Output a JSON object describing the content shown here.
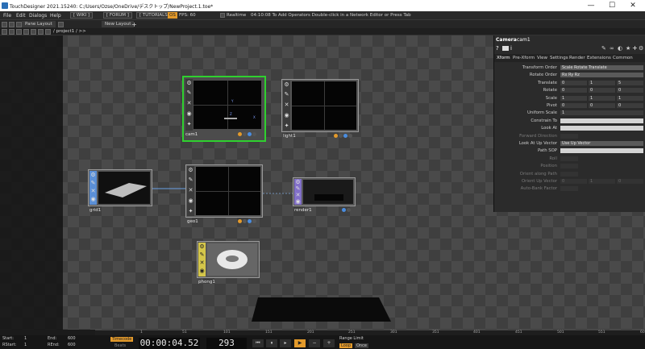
{
  "window": {
    "title": "TouchDesigner 2021.15240: C:/Users/Ozse/OneDrive/デスクトップ/NewProject.1.toe*",
    "minimize": "—",
    "maximize": "☐",
    "close": "✕"
  },
  "menu": {
    "items": [
      "File",
      "Edit",
      "Dialogs",
      "Help"
    ],
    "wiki": "[ WIKI ]",
    "forum": "[ FORUM ]",
    "tutorials": "[ TUTORIALS ]",
    "os_tag": "OS",
    "fps": "FPS:  60",
    "realtime": "Realtime",
    "status": "04:10:08 To Add Operators Double-click in a Network Editor or Press Tab"
  },
  "panebar": {
    "pane_layout": "Pane Layout",
    "new_layout": "New Layout",
    "add": "+"
  },
  "pathbar": {
    "path": "/  project1  /  >>"
  },
  "nodes": {
    "cam1": {
      "label": "cam1",
      "axis_y": "Y",
      "axis_x": "X",
      "axis_z": "Z"
    },
    "light1": {
      "label": "light1"
    },
    "grid1": {
      "label": "grid1"
    },
    "geo1": {
      "label": "geo1"
    },
    "render1": {
      "label": "render1"
    },
    "phong1": {
      "label": "phong1"
    }
  },
  "params": {
    "type": "Camera",
    "name": "cam1",
    "tabs": [
      "Xform",
      "Pre-Xform",
      "View",
      "Settings",
      "Render",
      "Extensions",
      "Common"
    ],
    "rows": [
      {
        "label": "Transform Order",
        "kind": "menu",
        "value": "Scale Rotate Translate"
      },
      {
        "label": "Rotate Order",
        "kind": "menu",
        "value": "Rx Ry Rz"
      },
      {
        "label": "Translate",
        "kind": "xyz",
        "values": [
          "0",
          "1",
          "5"
        ]
      },
      {
        "label": "Rotate",
        "kind": "xyz",
        "values": [
          "0",
          "0",
          "0"
        ]
      },
      {
        "label": "Scale",
        "kind": "xyz",
        "values": [
          "1",
          "1",
          "1"
        ]
      },
      {
        "label": "Pivot",
        "kind": "xyz",
        "values": [
          "0",
          "0",
          "0"
        ]
      },
      {
        "label": "Uniform Scale",
        "kind": "num",
        "value": "1"
      },
      {
        "label": "Constrain To",
        "kind": "field",
        "value": ""
      },
      {
        "label": "Look At",
        "kind": "field",
        "value": ""
      },
      {
        "label": "Forward Direction",
        "kind": "dim",
        "value": ""
      },
      {
        "label": "Look At Up Vector",
        "kind": "menu",
        "value": "Use Up Vector"
      },
      {
        "label": "Path SOP",
        "kind": "field",
        "value": ""
      },
      {
        "label": "Roll",
        "kind": "dim",
        "value": ""
      },
      {
        "label": "Position",
        "kind": "dim",
        "value": ""
      },
      {
        "label": "Orient along Path",
        "kind": "dim",
        "value": ""
      },
      {
        "label": "Orient Up Vector",
        "kind": "dimxyz",
        "values": [
          "0",
          "1",
          "0"
        ]
      },
      {
        "label": "Auto-Bank Factor",
        "kind": "dim",
        "value": ""
      }
    ]
  },
  "ruler": {
    "ticks": [
      "1",
      "51",
      "101",
      "151",
      "201",
      "251",
      "301",
      "351",
      "401",
      "451",
      "501",
      "551",
      "600"
    ]
  },
  "timeline": {
    "start_label": "Start:",
    "start": "1",
    "end_label": "End:",
    "end": "600",
    "rstart_label": "RStart:",
    "rstart": "1",
    "rend_label": "REnd:",
    "rend": "600",
    "timecode_btn": "Timecode",
    "beats_btn": "Beats",
    "timecode": "00:00:04.52",
    "frame": "293",
    "range_limit": "Range Limit",
    "loop": "Loop",
    "once": "Once"
  },
  "colors": {
    "selected_node_border": "#2fd12f",
    "comp_tab": "#5b8fd6",
    "mat_tab": "#d4c64a",
    "render_tab": "#8270c9",
    "os_tag": "#e39a2b"
  }
}
